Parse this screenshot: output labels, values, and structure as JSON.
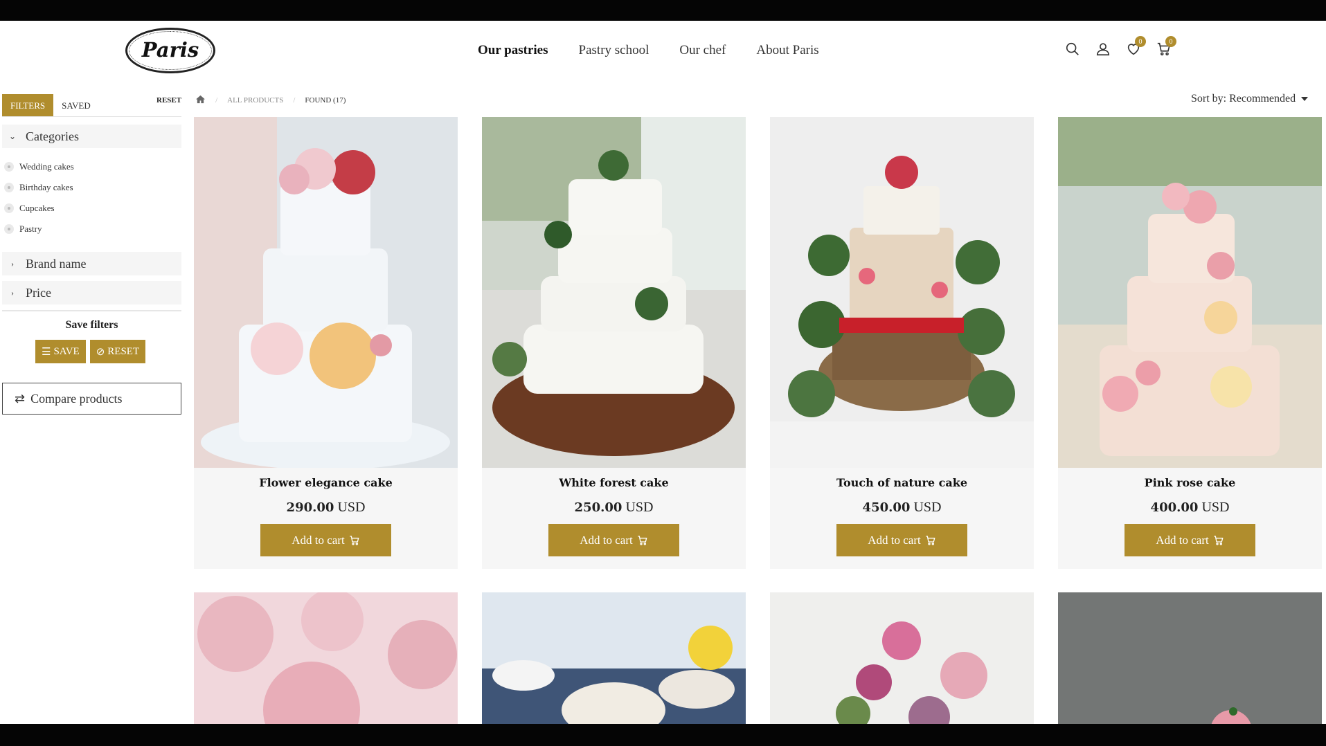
{
  "header": {
    "logo": "Paris",
    "nav": [
      "Our pastries",
      "Pastry school",
      "Our chef",
      "About Paris"
    ],
    "wishlist_count": "0",
    "cart_count": "0",
    "icons": [
      "search-icon",
      "user-icon",
      "heart-icon",
      "cart-icon"
    ]
  },
  "sidebar": {
    "tabs": [
      "FILTERS",
      "SAVED"
    ],
    "categories_label": "Categories",
    "categories": [
      "Wedding cakes",
      "Birthday cakes",
      "Cupcakes",
      "Pastry"
    ],
    "brand_label": "Brand name",
    "price_label": "Price",
    "save_filters_label": "Save filters",
    "save_button": "SAVE",
    "reset_button": "RESET",
    "compare_label": "Compare products"
  },
  "breadcrumb": {
    "reset": "RESET",
    "all_products": "ALL PRODUCTS",
    "found": "FOUND (17)"
  },
  "sort_label": "Sort by: Recommended",
  "products": [
    {
      "title": "Flower elegance cake",
      "price": "290.00",
      "currency": "USD",
      "cart_label": "Add to cart"
    },
    {
      "title": "White forest cake",
      "price": "250.00",
      "currency": "USD",
      "cart_label": "Add to cart"
    },
    {
      "title": "Touch of nature cake",
      "price": "450.00",
      "currency": "USD",
      "cart_label": "Add to cart"
    },
    {
      "title": "Pink rose cake",
      "price": "400.00",
      "currency": "USD",
      "cart_label": "Add to cart"
    }
  ],
  "colors": {
    "accent": "#b08d2d",
    "panel": "#f6f6f6"
  }
}
